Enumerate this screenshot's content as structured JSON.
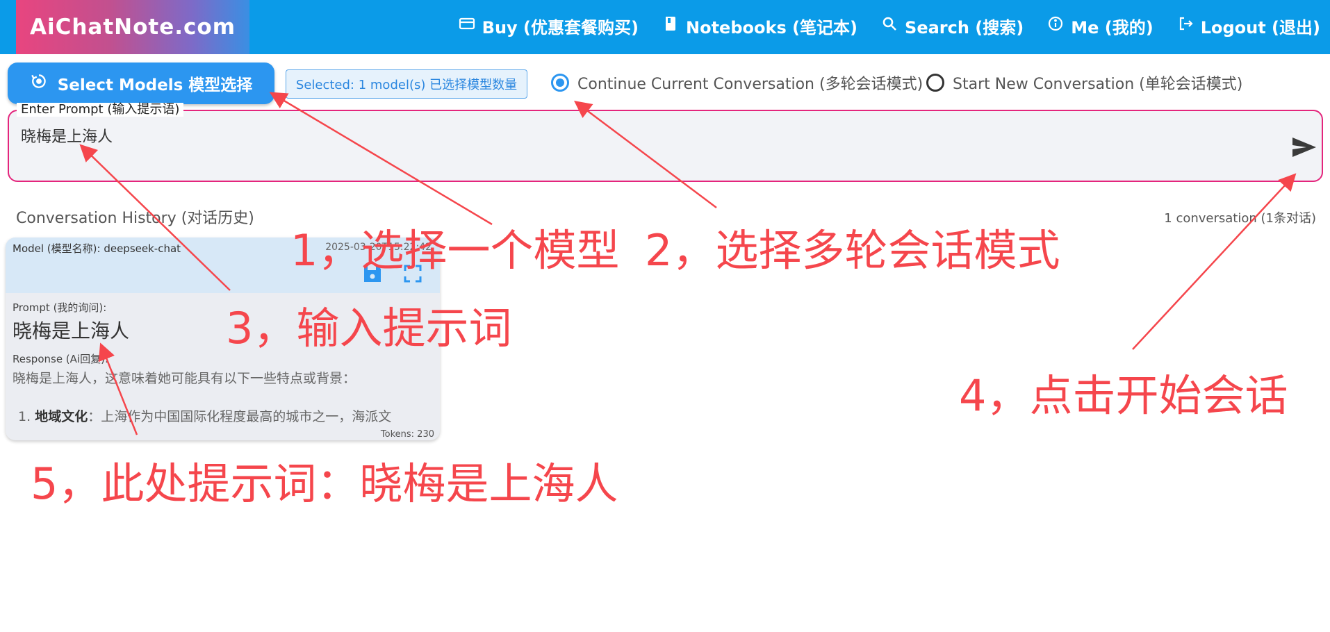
{
  "header": {
    "brand": "AiChatNote.com",
    "nav": [
      {
        "icon": "credit-card-icon",
        "label": "Buy (优惠套餐购买)"
      },
      {
        "icon": "notebook-icon",
        "label": "Notebooks (笔记本)"
      },
      {
        "icon": "search-icon",
        "label": "Search (搜索)"
      },
      {
        "icon": "info-icon",
        "label": "Me (我的)"
      },
      {
        "icon": "logout-icon",
        "label": "Logout (退出)"
      }
    ]
  },
  "toolbar": {
    "select_models_label": "Select Models 模型选择",
    "selected_chip": "Selected: 1 model(s) 已选择模型数量",
    "continue_label": "Continue Current Conversation (多轮会话模式)",
    "new_label": "Start New Conversation (单轮会话模式)",
    "selected_mode": "continue"
  },
  "prompt": {
    "legend": "Enter Prompt (输入提示语)",
    "value": "晓梅是上海人"
  },
  "history": {
    "title": "Conversation History (对话历史)",
    "count": "1 conversation (1条对话)",
    "card": {
      "model": "Model (模型名称): deepseek-chat",
      "date": "2025-03-20T15:22:42",
      "prompt_label": "Prompt (我的询问):",
      "prompt": "晓梅是上海人",
      "response_label": "Response (Ai回复):",
      "response": "晓梅是上海人，这意味着她可能具有以下一些特点或背景：",
      "list_num": "1.",
      "list_bold": "地域文化",
      "list_text": "：上海作为中国国际化程度最高的城市之一，海派文",
      "tokens": "Tokens: 230"
    }
  },
  "annotations": {
    "a1": "1，选择一个模型",
    "a2": "2，选择多轮会话模式",
    "a3": "3，输入提示词",
    "a4": "4，点击开始会话",
    "a5": "5，此处提示词：晓梅是上海人"
  },
  "colors": {
    "header": "#0b9be8",
    "accent": "#2c96f0",
    "prompt_border": "#e4257c",
    "annotation": "#f5464c"
  }
}
